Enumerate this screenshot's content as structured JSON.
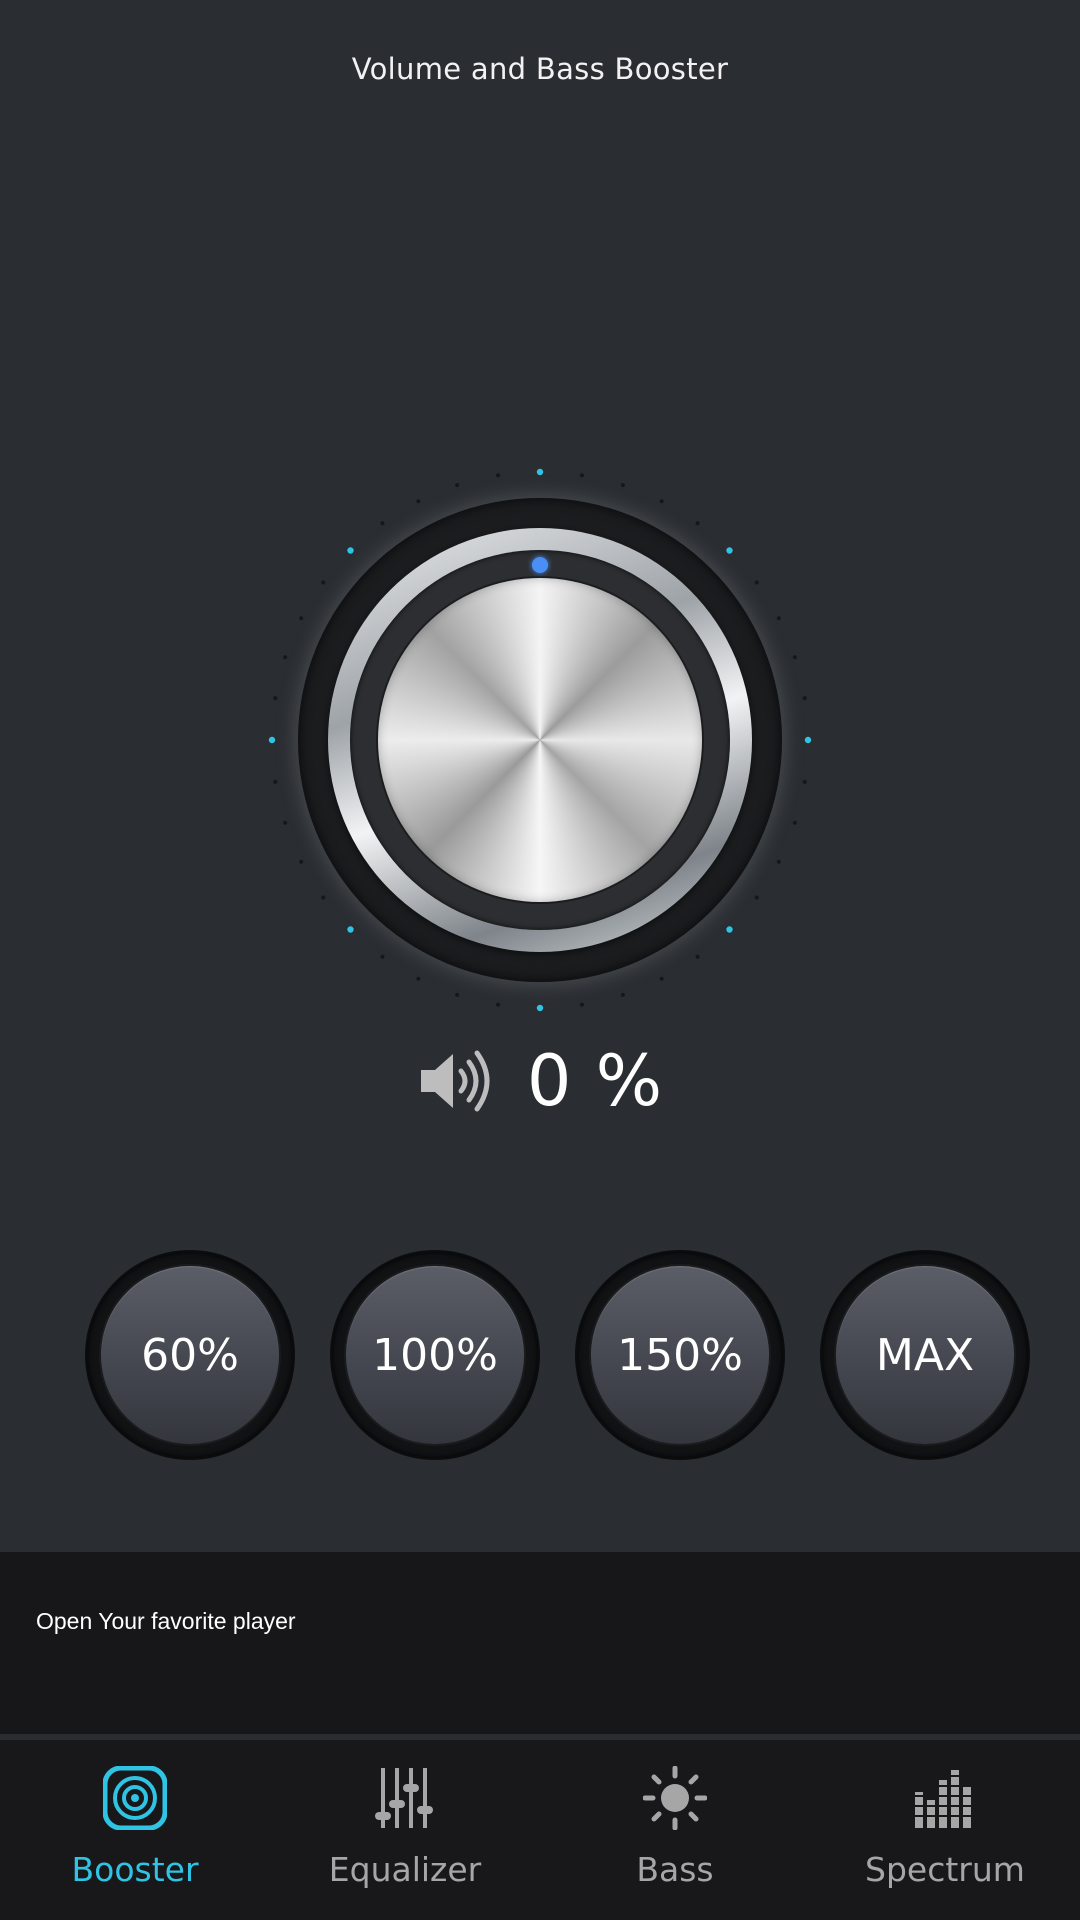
{
  "header": {
    "title": "Volume and Bass Booster"
  },
  "knob": {
    "level_percent": 0,
    "indicator_color": "#4a8ff5",
    "tick_accent_color": "#2fc3e4"
  },
  "volume": {
    "value": "0 %",
    "icon": "speaker-icon"
  },
  "presets": [
    {
      "label": "60%"
    },
    {
      "label": "100%"
    },
    {
      "label": "150%"
    },
    {
      "label": "MAX"
    }
  ],
  "banner": {
    "text": "Open Your favorite player"
  },
  "nav": {
    "active_color": "#2fc3e4",
    "inactive_color": "#a6a6a6",
    "items": [
      {
        "label": "Booster",
        "icon": "booster-icon",
        "active": true
      },
      {
        "label": "Equalizer",
        "icon": "equalizer-icon",
        "active": false
      },
      {
        "label": "Bass",
        "icon": "bass-icon",
        "active": false
      },
      {
        "label": "Spectrum",
        "icon": "spectrum-icon",
        "active": false
      }
    ]
  }
}
